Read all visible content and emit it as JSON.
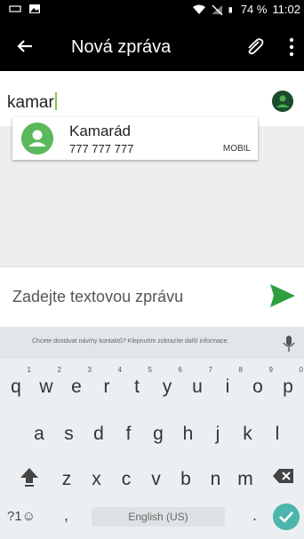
{
  "status_bar": {
    "battery": "74 %",
    "time": "11:02"
  },
  "toolbar": {
    "title": "Nová zpráva"
  },
  "recipient": {
    "typed": "kamar"
  },
  "suggestion": {
    "name": "Kamarád",
    "number": "777 777 777",
    "type": "MOBIL"
  },
  "compose": {
    "placeholder": "Zadejte textovou zprávu"
  },
  "keyboard": {
    "hint": "Chcete dostávat návrhy kontaktů? Klepnutím zobrazíte další informace.",
    "row1": [
      {
        "k": "q",
        "s": "1"
      },
      {
        "k": "w",
        "s": "2"
      },
      {
        "k": "e",
        "s": "3"
      },
      {
        "k": "r",
        "s": "4"
      },
      {
        "k": "t",
        "s": "5"
      },
      {
        "k": "y",
        "s": "6"
      },
      {
        "k": "u",
        "s": "7"
      },
      {
        "k": "i",
        "s": "8"
      },
      {
        "k": "o",
        "s": "9"
      },
      {
        "k": "p",
        "s": "0"
      }
    ],
    "row2": [
      "a",
      "s",
      "d",
      "f",
      "g",
      "h",
      "j",
      "k",
      "l"
    ],
    "row3": [
      "z",
      "x",
      "c",
      "v",
      "b",
      "n",
      "m"
    ],
    "symbols_label": "?1☺",
    "comma": ",",
    "space_label": "English (US)",
    "period": "."
  },
  "colors": {
    "accent_green": "#4caf50",
    "send_green": "#2e9e3e",
    "enter_teal": "#4db6ac",
    "caret": "#8bc34a"
  },
  "icons": [
    "back-arrow-icon",
    "attach-icon",
    "more-vert-icon",
    "contact-avatar-icon",
    "send-icon",
    "mic-icon",
    "shift-icon",
    "delete-icon",
    "enter-check-icon"
  ]
}
